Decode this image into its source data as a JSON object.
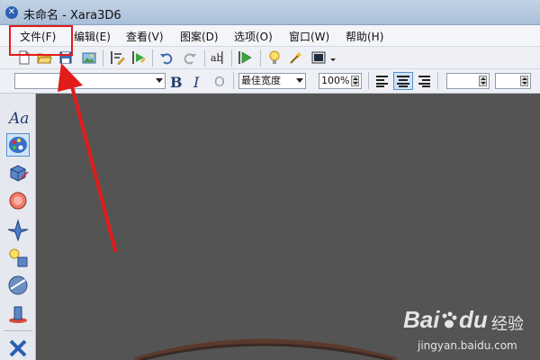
{
  "window": {
    "title": "未命名 - Xara3D6",
    "app_icon": "xara3d-app-icon"
  },
  "menu": {
    "items": [
      {
        "label": "文件(F)"
      },
      {
        "label": "编辑(E)"
      },
      {
        "label": "查看(V)"
      },
      {
        "label": "图案(D)"
      },
      {
        "label": "选项(O)"
      },
      {
        "label": "窗口(W)"
      },
      {
        "label": "帮助(H)"
      }
    ]
  },
  "toolbar": {
    "icons": [
      "new-document-icon",
      "open-folder-icon",
      "save-icon",
      "export-image-icon",
      "edit-text-icon",
      "animation-icon",
      "undo-icon",
      "redo-icon",
      "text-spell-icon",
      "play-animation-icon",
      "light-bulb-icon",
      "wand-icon",
      "display-mode-icon"
    ]
  },
  "format_bar": {
    "font_value": "",
    "bold": "B",
    "italic": "I",
    "outline": "O",
    "width_value": "最佳宽度",
    "zoom_value": "100%",
    "align": [
      "align-left-icon",
      "align-center-icon",
      "align-right-icon"
    ],
    "spacing_value": "",
    "line_value": ""
  },
  "sidebar": {
    "text_tool_label": "Aa",
    "tools": [
      "text-tool-icon",
      "color-palette-icon",
      "extrude-icon",
      "bevel-icon",
      "shape-icon",
      "lights-icon",
      "texture-icon",
      "shadow-icon",
      "xara-logo-icon"
    ]
  },
  "watermark": {
    "brand": "Bai",
    "brand2": "du",
    "suffix": "经验",
    "url": "jingyan.baidu.com"
  },
  "colors": {
    "accent": "#e21b1b",
    "canvas": "#545454",
    "highlight": "#cfe3f8"
  }
}
